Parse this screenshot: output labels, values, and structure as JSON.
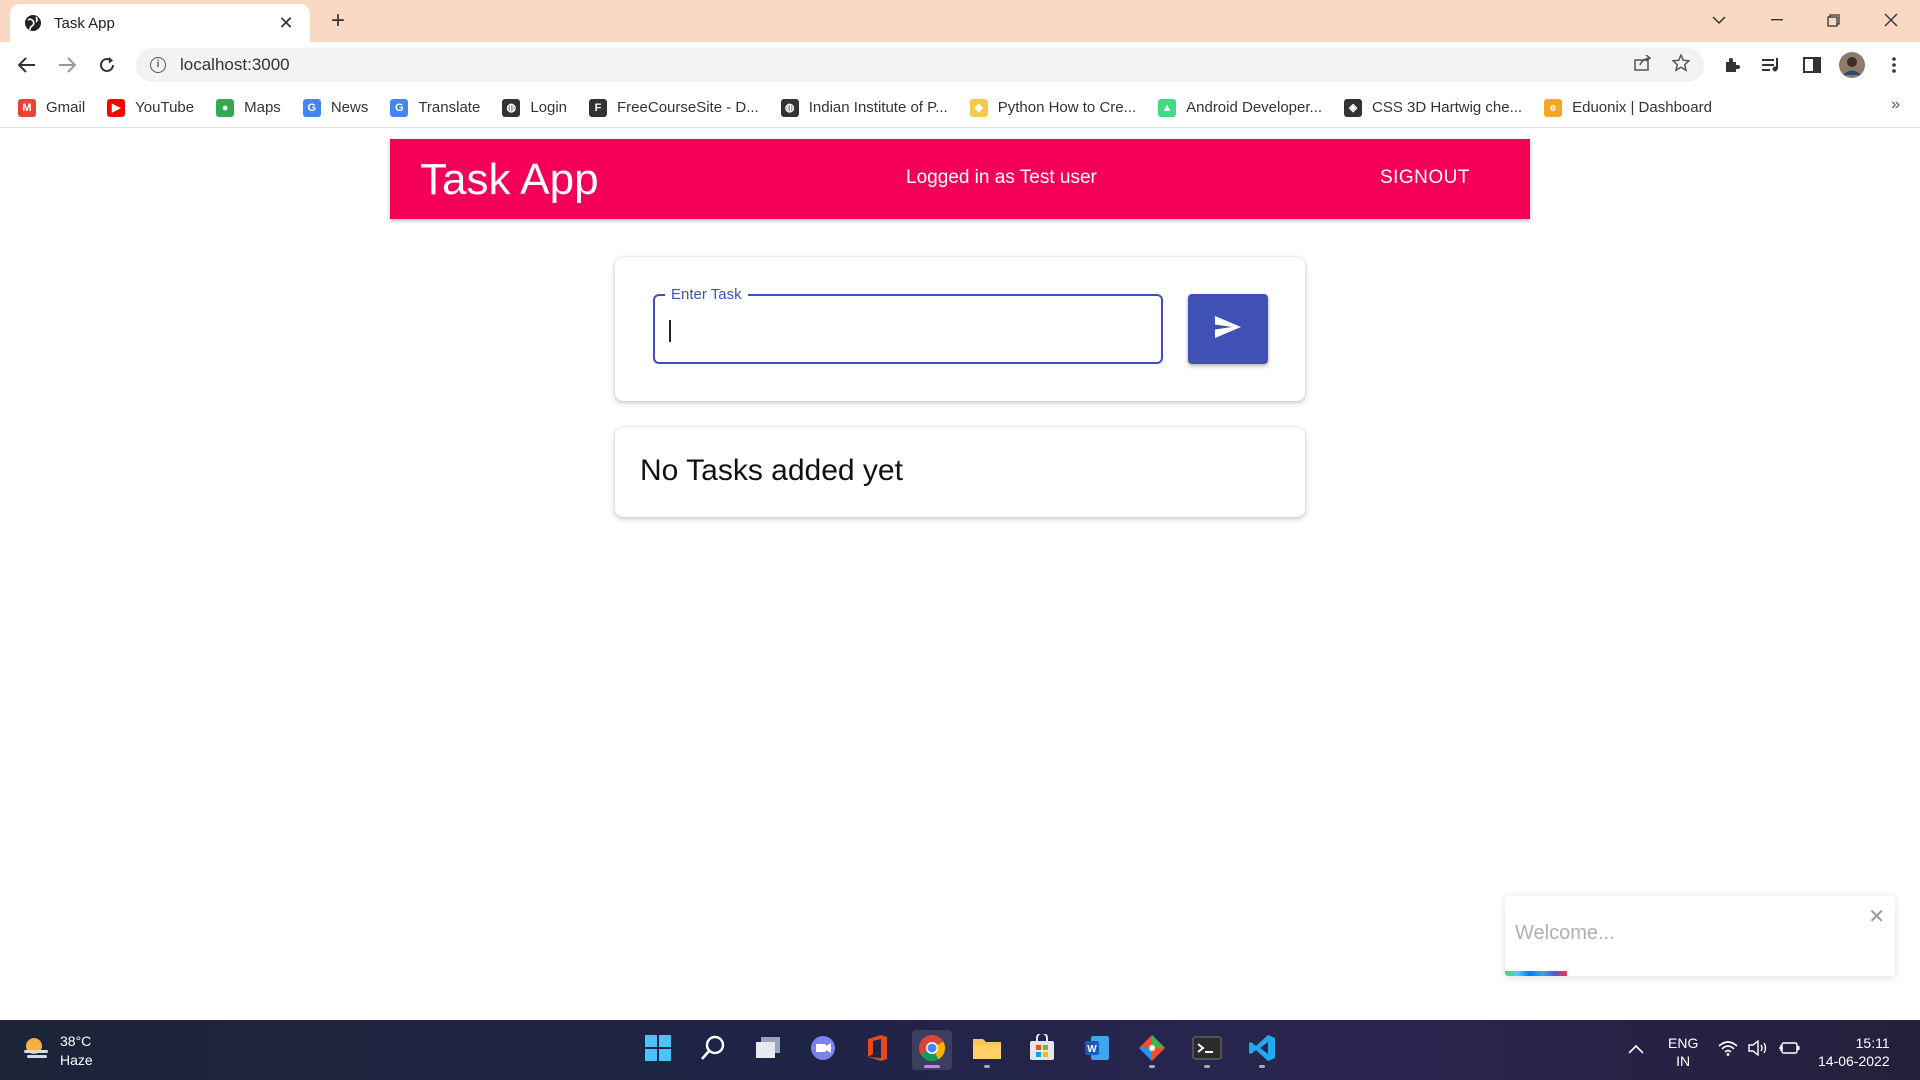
{
  "browser": {
    "tab_title": "Task App",
    "url": "localhost:3000",
    "bookmarks": [
      {
        "label": "Gmail",
        "color": "#ea4335",
        "glyph": "M"
      },
      {
        "label": "YouTube",
        "color": "#ff0000",
        "glyph": "▶"
      },
      {
        "label": "Maps",
        "color": "#34a853",
        "glyph": "●"
      },
      {
        "label": "News",
        "color": "#4285f4",
        "glyph": "G"
      },
      {
        "label": "Translate",
        "color": "#4285f4",
        "glyph": "G"
      },
      {
        "label": "Login",
        "color": "#333333",
        "glyph": "◍"
      },
      {
        "label": "FreeCourseSite - D...",
        "color": "#333333",
        "glyph": "F"
      },
      {
        "label": "Indian Institute of P...",
        "color": "#333333",
        "glyph": "◍"
      },
      {
        "label": "Python How to Cre...",
        "color": "#f7c948",
        "glyph": "◆"
      },
      {
        "label": "Android Developer...",
        "color": "#3ddc84",
        "glyph": "▲"
      },
      {
        "label": "CSS 3D Hartwig che...",
        "color": "#333333",
        "glyph": "◈"
      },
      {
        "label": "Eduonix | Dashboard",
        "color": "#f5a623",
        "glyph": "e"
      }
    ]
  },
  "app": {
    "title": "Task App",
    "user_text": "Logged in as Test user",
    "signout_label": "SIGNOUT",
    "accent": "#f50057",
    "primary": "#3f51b5"
  },
  "task_input": {
    "label": "Enter Task",
    "value": ""
  },
  "task_list": {
    "empty_message": "No Tasks added yet"
  },
  "toast": {
    "message": "Welcome...",
    "progress": 0.16
  },
  "taskbar": {
    "weather_temp": "38°C",
    "weather_desc": "Haze",
    "language_top": "ENG",
    "language_bottom": "IN",
    "time": "15:11",
    "date": "14-06-2022"
  }
}
